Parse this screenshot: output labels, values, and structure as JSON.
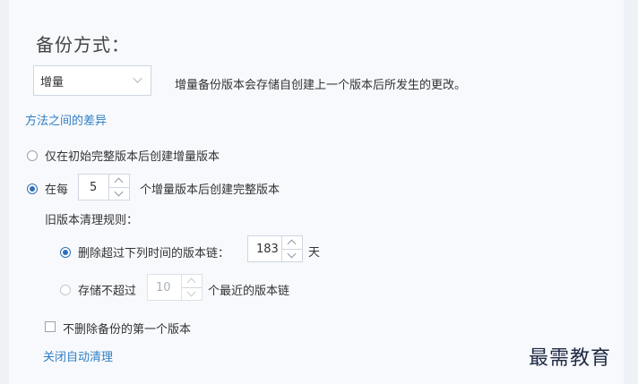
{
  "section_title": "备份方式：",
  "method_select": {
    "value": "增量"
  },
  "method_description": "增量备份版本会存储自创建上一个版本后所发生的更改。",
  "diff_link": "方法之间的差异",
  "radio_initial": {
    "label": "仅在初始完整版本后创建增量版本",
    "checked": false
  },
  "radio_every": {
    "label_prefix": "在每",
    "value": "5",
    "label_suffix": "个增量版本后创建完整版本",
    "checked": true
  },
  "cleanup_title": "旧版本清理规则：",
  "cleanup_delete": {
    "label": "删除超过下列时间的版本链：",
    "value": "183",
    "unit": "天",
    "checked": true
  },
  "cleanup_keep": {
    "label_prefix": "存储不超过",
    "value": "10",
    "label_suffix": "个最近的版本链",
    "checked": false
  },
  "keep_first_checkbox": {
    "label": "不删除备份的第一个版本",
    "checked": false
  },
  "disable_cleanup_link": "关闭自动清理",
  "watermark": "最需教育",
  "colors": {
    "accent": "#2f6fb8",
    "link": "#2f7ec4",
    "background": "#f7f9fc"
  },
  "icons": {
    "select_caret": "chevron-down-icon",
    "spin_up": "chevron-up-icon",
    "spin_down": "chevron-down-icon"
  }
}
